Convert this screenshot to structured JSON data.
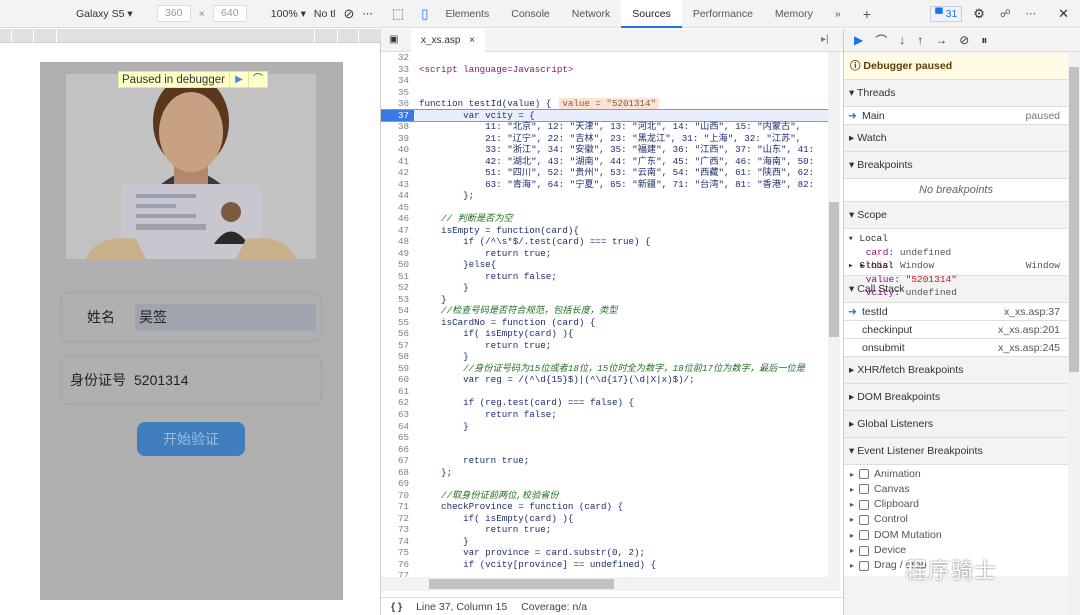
{
  "device_toolbar": {
    "device": "Galaxy S5",
    "width": "360",
    "height": "640",
    "zoom": "100%",
    "throttle": "No tl",
    "more": "⋯"
  },
  "page": {
    "paused_label": "Paused in debugger",
    "name_label": "姓名",
    "name_value": "吴签",
    "id_label": "身份证号",
    "id_value": "5201314",
    "submit_label": "开始验证"
  },
  "devtools": {
    "tabs": [
      "Elements",
      "Console",
      "Network",
      "Sources",
      "Performance",
      "Memory"
    ],
    "active_tab": "Sources",
    "issues_count": "31",
    "file_tab": "x_xs.asp",
    "current_line": 37,
    "inline_value": "value = \"5201314\"",
    "status": {
      "position": "Line 37, Column 15",
      "coverage": "Coverage: n/a"
    },
    "code_start": 32,
    "code": [
      "",
      "<script language=Javascript>",
      "",
      "",
      "function testId(value) {",
      "        var vcity = {",
      "            11: \"北京\", 12: \"天津\", 13: \"河北\", 14: \"山西\", 15: \"内蒙古\",",
      "            21: \"辽宁\", 22: \"吉林\", 23: \"黑龙江\", 31: \"上海\", 32: \"江苏\",",
      "            33: \"浙江\", 34: \"安徽\", 35: \"福建\", 36: \"江西\", 37: \"山东\", 41:",
      "            42: \"湖北\", 43: \"湖南\", 44: \"广东\", 45: \"广西\", 46: \"海南\", 50:",
      "            51: \"四川\", 52: \"贵州\", 53: \"云南\", 54: \"西藏\", 61: \"陕西\", 62:",
      "            63: \"青海\", 64: \"宁夏\", 65: \"新疆\", 71: \"台湾\", 81: \"香港\", 82:",
      "        };",
      "",
      "    // 判断是否为空",
      "    isEmpty = function(card){",
      "        if (/^\\s*$/.test(card) === true) {",
      "            return true;",
      "        }else{",
      "            return false;",
      "        }",
      "    }",
      "    //检查号码是否符合规范，包括长度，类型",
      "    isCardNo = function (card) {",
      "        if( isEmpty(card) ){",
      "            return true;",
      "        }",
      "        //身份证号码为15位或者18位，15位时全为数字，18位前17位为数字，最后一位是",
      "        var reg = /(^\\d{15}$)|(^\\d{17}(\\d|X|x)$)/;",
      "",
      "        if (reg.test(card) === false) {",
      "            return false;",
      "        }",
      "",
      "",
      "        return true;",
      "    };",
      "",
      "    //取身份证前两位,校验省份",
      "    checkProvince = function (card) {",
      "        if( isEmpty(card) ){",
      "            return true;",
      "        }",
      "        var province = card.substr(0, 2);",
      "        if (vcity[province] == undefined) {",
      ""
    ]
  },
  "debugger": {
    "banner": "Debugger paused",
    "threads": {
      "title": "Threads",
      "items": [
        {
          "name": "Main",
          "state": "paused"
        }
      ]
    },
    "watch": "Watch",
    "breakpoints": {
      "title": "Breakpoints",
      "empty": "No breakpoints"
    },
    "scope": {
      "title": "Scope",
      "local": "Local",
      "vars": [
        {
          "k": "card",
          "v": "undefined"
        },
        {
          "k": "this",
          "v": "Window"
        },
        {
          "k": "value",
          "v": "\"5201314\""
        },
        {
          "k": "vcity",
          "v": "undefined"
        }
      ],
      "global": "Global",
      "global_value": "Window"
    },
    "call_stack": {
      "title": "Call Stack",
      "frames": [
        {
          "fn": "testId",
          "loc": "x_xs.asp:37"
        },
        {
          "fn": "checkinput",
          "loc": "x_xs.asp:201"
        },
        {
          "fn": "onsubmit",
          "loc": "x_xs.asp:245"
        }
      ]
    },
    "sections": [
      "XHR/fetch Breakpoints",
      "DOM Breakpoints",
      "Global Listeners"
    ],
    "event_listeners": {
      "title": "Event Listener Breakpoints",
      "items": [
        "Animation",
        "Canvas",
        "Clipboard",
        "Control",
        "DOM Mutation",
        "Device",
        "Drag / drop"
      ]
    }
  },
  "watermark": "程序骑士",
  "colors": {
    "accent": "#1a73e8",
    "paused_bg": "#fffbe5",
    "current_line": "#3b78e7",
    "button": "#3f7dbd"
  }
}
